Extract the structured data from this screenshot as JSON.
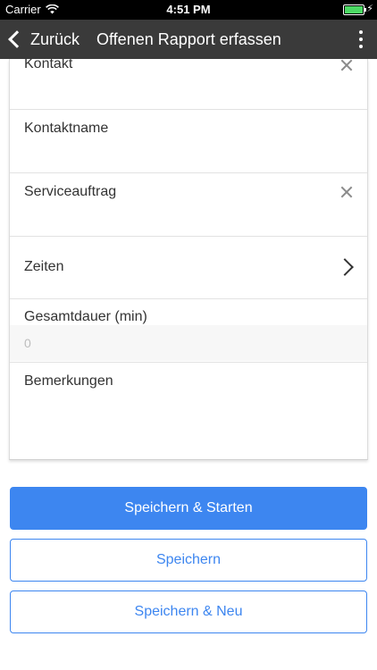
{
  "status_bar": {
    "carrier": "Carrier",
    "time": "4:51 PM",
    "battery_level": 1.0
  },
  "nav": {
    "back_label": "Zurück",
    "title": "Offenen Rapport erfassen"
  },
  "form": {
    "fields": [
      {
        "label": "Kontakt",
        "clearable": true
      },
      {
        "label": "Kontaktname",
        "clearable": false
      },
      {
        "label": "Serviceauftrag",
        "clearable": true
      },
      {
        "label": "Zeiten",
        "navigable": true
      },
      {
        "label": "Gesamtdauer (min)",
        "placeholder": "0"
      },
      {
        "label": "Bemerkungen"
      }
    ]
  },
  "actions": {
    "save_start": "Speichern & Starten",
    "save": "Speichern",
    "save_new": "Speichern & Neu"
  },
  "colors": {
    "accent": "#3d86f0",
    "nav_background": "#3a3a3a",
    "battery": "#4cd964"
  }
}
